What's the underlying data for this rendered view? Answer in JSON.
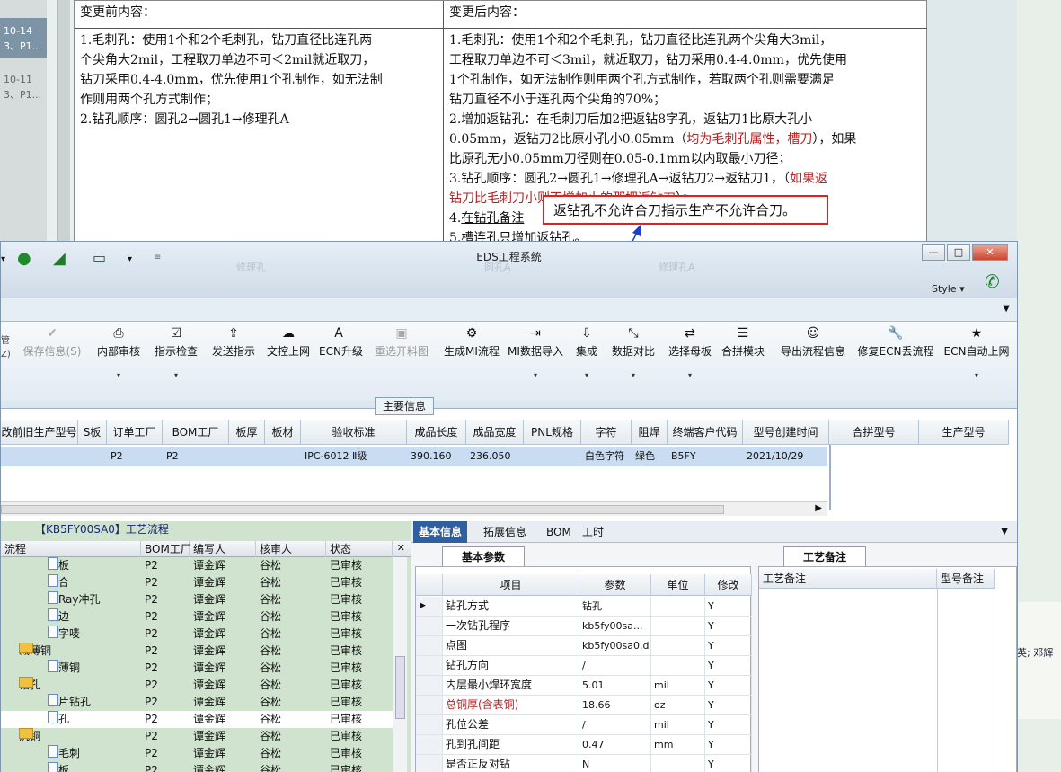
{
  "bg_list": {
    "items": [
      {
        "date": "10-14",
        "sub": "3、P1..."
      },
      {
        "date": "10-11",
        "sub": "3、P1..."
      }
    ]
  },
  "doc": {
    "before_header": "变更前内容：",
    "after_header": "变更后内容：",
    "before_lines": [
      "1.毛刺孔：使用1个和2个毛刺孔，钻刀直径比连孔两",
      "个尖角大2mil，工程取刀单边不可＜2mil就近取刀，",
      "钻刀采用0.4-4.0mm，优先使用1个孔制作，如无法制",
      "作则用两个孔方式制作；",
      "2.钻孔顺序：圆孔2→圆孔1→修理孔A"
    ],
    "after_lines": {
      "l1": "1.毛刺孔：使用1个和2个毛刺孔，钻刀直径比连孔两个尖角大3mil，",
      "l2": "工程取刀单边不可＜3mil，就近取刀，钻刀采用0.4-4.0mm，优先使用",
      "l3": "1个孔制作，如无法制作则用两个孔方式制作，若取两个孔则需要满足",
      "l4": "钻刀直径不小于连孔两个尖角的70%；",
      "l5": "2.增加返钻孔：在毛刺刀后加2把返钻8字孔，返钻刀1比原大孔小",
      "l6a": "0.05mm，返钻刀2比原小孔小0.05mm（",
      "l6b": "均为毛刺孔属性，槽刀",
      "l6c": "），如果",
      "l7": "比原孔无小0.05mm刀径则在0.05-0.1mm以内取最小刀径；",
      "l8a": "3.钻孔顺序：圆孔2→圆孔1→修理孔A→返钻刀2→返钻刀1，（",
      "l8b": "如果返",
      "l9a": "钻刀比毛刺刀小则不增加小的那把返钻刀",
      "l9b": "）；",
      "l10a": "4.",
      "l10b": "在钻孔备注",
      "l11": "5.槽连孔只增加返钻孔。"
    },
    "callout": "返钻孔不允许合刀指示生产不允许合刀。"
  },
  "window": {
    "title": "EDS工程系统",
    "style_label": "Style",
    "ghost_labels": [
      "修理孔",
      "圆孔A",
      "修理孔A"
    ],
    "buttons": {
      "minimize": "—",
      "maximize": "□",
      "close": "✕"
    }
  },
  "ribbon": {
    "items": [
      {
        "label": "保存信息(S)",
        "icon": "✔",
        "disabled": true,
        "arrow": ""
      },
      {
        "label": "内部审核",
        "icon": "⎙",
        "disabled": false,
        "arrow": "▾"
      },
      {
        "label": "指示检查",
        "icon": "☑",
        "disabled": false,
        "arrow": "▾"
      },
      {
        "label": "发送指示",
        "icon": "⇪",
        "disabled": false,
        "arrow": ""
      },
      {
        "label": "文控上网",
        "icon": "☁",
        "disabled": false,
        "arrow": ""
      },
      {
        "label": "ECN升级",
        "icon": "A",
        "disabled": false,
        "arrow": ""
      },
      {
        "label": "重选开料图",
        "icon": "▣",
        "disabled": true,
        "arrow": ""
      },
      {
        "label": "生成MI流程",
        "icon": "⚙",
        "disabled": false,
        "arrow": ""
      },
      {
        "label": "MI数据导入",
        "icon": "⇥",
        "disabled": false,
        "arrow": "▾"
      },
      {
        "label": "集成",
        "icon": "⇩",
        "disabled": false,
        "arrow": "▾"
      },
      {
        "label": "数据对比",
        "icon": "⤡",
        "disabled": false,
        "arrow": "▾"
      },
      {
        "label": "选择母板",
        "icon": "⇄",
        "disabled": false,
        "arrow": "▾"
      },
      {
        "label": "合拼模块",
        "icon": "☰",
        "disabled": false,
        "arrow": ""
      },
      {
        "label": "导出流程信息",
        "icon": "☺",
        "disabled": false,
        "arrow": ""
      },
      {
        "label": "修复ECN丢流程",
        "icon": "🔧",
        "disabled": false,
        "arrow": ""
      },
      {
        "label": "ECN自动上网",
        "icon": "★",
        "disabled": false,
        "arrow": "▾"
      }
    ],
    "left_small": [
      "管",
      "Z)"
    ]
  },
  "main_info": {
    "label": "主要信息",
    "headers": [
      "改前旧生产型号",
      "S板",
      "订单工厂",
      "BOM工厂",
      "板厚",
      "板材",
      "验收标准",
      "成品长度",
      "成品宽度",
      "PNL规格",
      "字符",
      "阻焊",
      "终端客户代码",
      "型号创建时间"
    ],
    "row": [
      "",
      "",
      "P2",
      "P2",
      "",
      "",
      "IPC-6012 Ⅱ级",
      "390.160",
      "236.050",
      "",
      "白色字符",
      "绿色",
      "B5FY",
      "2021/10/29"
    ],
    "right_headers": [
      "合拼型号",
      "生产型号"
    ]
  },
  "tree": {
    "title": "【KB5FY00SA0】工艺流程",
    "headers": [
      "流程",
      "BOM工厂",
      "编写人",
      "核审人",
      "状态"
    ],
    "rows": [
      {
        "name": "排板",
        "type": "item",
        "bom": "P2",
        "writer": "谭金辉",
        "checker": "谷松",
        "status": "已审核"
      },
      {
        "name": "压合",
        "type": "item",
        "bom": "P2",
        "writer": "谭金辉",
        "checker": "谷松",
        "status": "已审核"
      },
      {
        "name": "X-Ray冲孔",
        "type": "item",
        "bom": "P2",
        "writer": "谭金辉",
        "checker": "谷松",
        "status": "已审核"
      },
      {
        "name": "铣边",
        "type": "item",
        "bom": "P2",
        "writer": "谭金辉",
        "checker": "谷松",
        "status": "已审核"
      },
      {
        "name": "打字唛",
        "type": "item",
        "bom": "P2",
        "writer": "谭金辉",
        "checker": "谷松",
        "status": "已审核"
      },
      {
        "name": "减薄铜",
        "type": "folder",
        "bom": "P2",
        "writer": "谭金辉",
        "checker": "谷松",
        "status": "已审核"
      },
      {
        "name": "减薄铜",
        "type": "item",
        "bom": "P2",
        "writer": "谭金辉",
        "checker": "谷松",
        "status": "已审核"
      },
      {
        "name": "钻孔",
        "type": "folder",
        "bom": "P2",
        "writer": "谭金辉",
        "checker": "谷松",
        "status": "已审核"
      },
      {
        "name": "铝片钻孔",
        "type": "item",
        "bom": "P2",
        "writer": "谭金辉",
        "checker": "谷松",
        "status": "已审核"
      },
      {
        "name": "钻孔",
        "type": "item",
        "bom": "P2",
        "writer": "谭金辉",
        "checker": "谷松",
        "status": "已审核"
      },
      {
        "name": "沉铜",
        "type": "folder",
        "bom": "P2",
        "writer": "谭金辉",
        "checker": "谷松",
        "status": "已审核"
      },
      {
        "name": "去毛刺",
        "type": "item",
        "bom": "P2",
        "writer": "谭金辉",
        "checker": "谷松",
        "status": "已审核"
      },
      {
        "name": "烘板",
        "type": "item",
        "bom": "P2",
        "writer": "谭金辉",
        "checker": "谷松",
        "status": "已审核"
      }
    ]
  },
  "lower": {
    "tabs": [
      "基本信息",
      "拓展信息",
      "BOM",
      "工时"
    ],
    "basic_label": "基本参数",
    "craft_label": "工艺备注",
    "param_headers": [
      "项目",
      "参数",
      "单位",
      "修改"
    ],
    "params": [
      {
        "item": "钻孔方式",
        "value": "钻孔",
        "unit": "",
        "mod": "Y",
        "red": false
      },
      {
        "item": "一次钻孔程序",
        "value": "kb5fy00sa...",
        "unit": "",
        "mod": "Y",
        "red": false
      },
      {
        "item": "点图",
        "value": "kb5fy00sa0.d",
        "unit": "",
        "mod": "Y",
        "red": false
      },
      {
        "item": "钻孔方向",
        "value": "/",
        "unit": "",
        "mod": "Y",
        "red": false
      },
      {
        "item": "内层最小焊环宽度",
        "value": "5.01",
        "unit": "mil",
        "mod": "Y",
        "red": false
      },
      {
        "item": "总铜厚(含表铜)",
        "value": "18.66",
        "unit": "oz",
        "mod": "Y",
        "red": true
      },
      {
        "item": "孔位公差",
        "value": "/",
        "unit": "mil",
        "mod": "Y",
        "red": false
      },
      {
        "item": "孔到孔间距",
        "value": "0.47",
        "unit": "mm",
        "mod": "Y",
        "red": false
      },
      {
        "item": "是否正反对钻",
        "value": "N",
        "unit": "",
        "mod": "Y",
        "red": false
      }
    ],
    "craft_headers": [
      "工艺备注",
      "型号备注"
    ]
  },
  "bg_right_text": "英; 邓辉",
  "colors": {
    "accent": "#2f5f9f",
    "red_text": "#b52020",
    "callout_border": "#dd2222"
  }
}
